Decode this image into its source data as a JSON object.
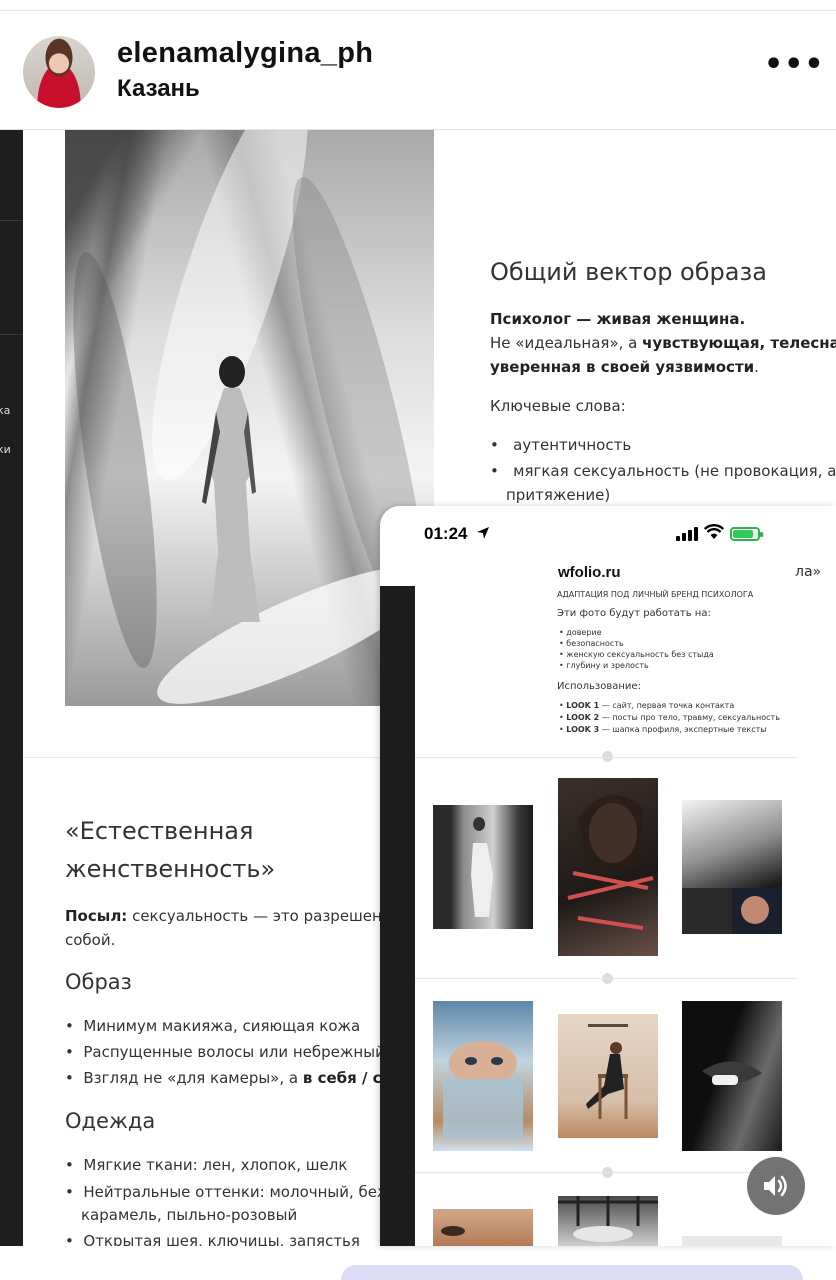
{
  "post_header": {
    "username": "elenamalygina_ph",
    "location": "Казань",
    "more_icon": "more-horizontal-icon"
  },
  "left_sidebar": {
    "fragments": [
      "ка",
      "ки"
    ]
  },
  "section_vector": {
    "title": "Общий вектор образа",
    "lead_bold": "Психолог — живая женщина.",
    "line2_pre": "Не «идеальная», а ",
    "line2_bold": "чувствующая, телесная,",
    "line3_bold": "уверенная в своей уязвимости",
    "line3_post": ".",
    "keywords_label": "Ключевые слова:",
    "bullets": [
      "аутентичность",
      "мягкая сексуальность (не провокация, а",
      "притяжение)"
    ]
  },
  "section_feminine": {
    "title_line1": "«Естественная",
    "title_line2": "женственность»",
    "message_label": "Посыл:",
    "message_text": " сексуальность — это разрешение",
    "message_line2": "собой.",
    "image_heading": "Образ",
    "image_bullets": [
      "Минимум макияжа, сияющая кожа",
      "Распущенные волосы или небрежный",
      "Взгляд не «для камеры», а "
    ],
    "image_bullet3_bold": "в себя / скво",
    "clothes_heading": "Одежда",
    "clothes_bullets": [
      "Мягкие ткани: лен, хлопок, шелк",
      "Нейтральные оттенки: молочный, беж,",
      "карамель, пыльно-розовый",
      "Открытая шея, ключицы, запястья"
    ]
  },
  "phone": {
    "time": "01:24",
    "url": "wfolio.ru",
    "url_right_fragment": "ла»",
    "card": {
      "top_label": "АДАПТАЦИЯ ПОД ЛИЧНЫЙ БРЕНД ПСИХОЛОГА",
      "works_for": "Эти фото будут работать на:",
      "works_items": [
        "доверие",
        "безопасность",
        "женскую сексуальность без стыда",
        "глубину и зрелость"
      ],
      "usage_label": "Использование:",
      "usage_items": [
        {
          "bold": "LOOK 1",
          "text": " — сайт, первая точка контакта"
        },
        {
          "bold": "LOOK 2",
          "text": " — посты про тело, травму, сексуальность"
        },
        {
          "bold": "LOOK 3",
          "text": " — шапка профиля, экспертные тексты"
        }
      ]
    }
  },
  "sound_button": {
    "icon": "speaker-icon"
  },
  "colors": {
    "battery": "#34c759",
    "sound_button_bg": "#5a5a5a",
    "bottom_pill": "#dcdcf5"
  }
}
